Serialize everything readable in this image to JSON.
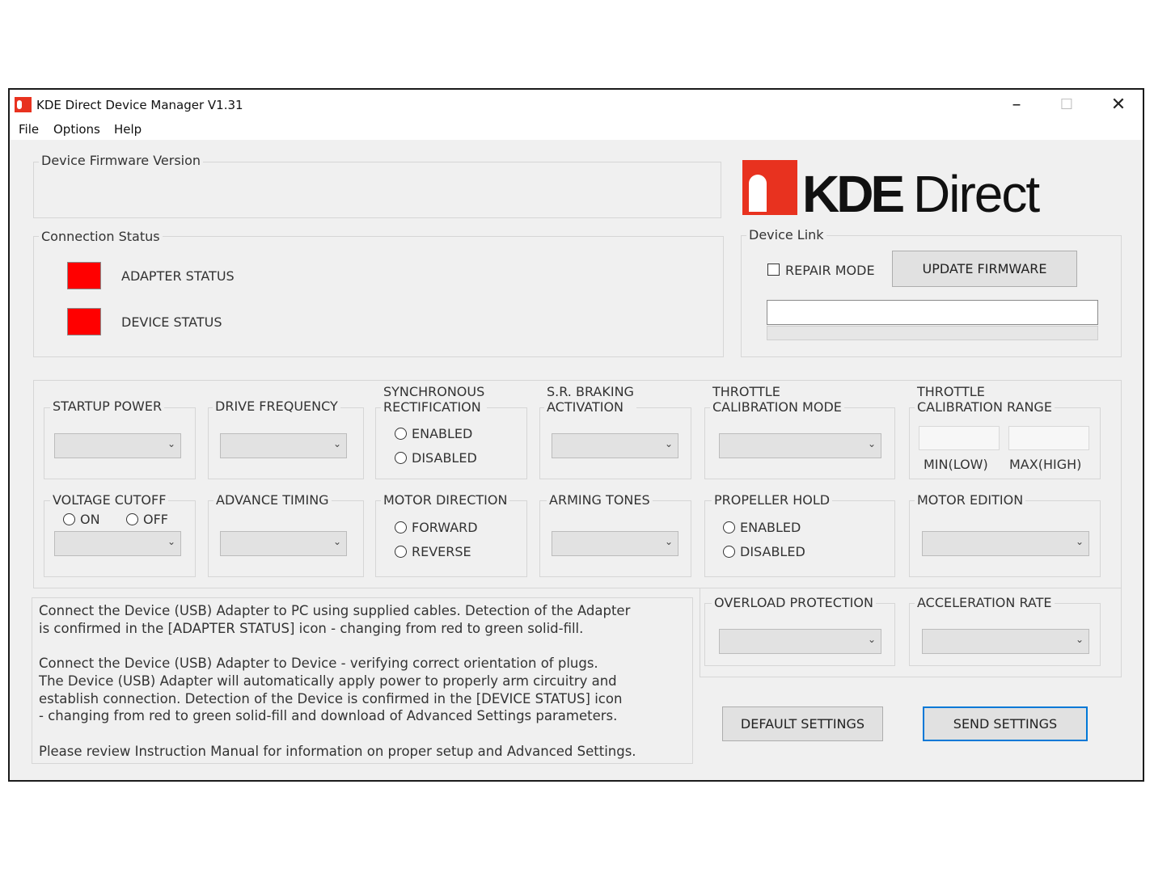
{
  "window": {
    "title": "KDE Direct Device Manager V1.31"
  },
  "menu": [
    "File",
    "Options",
    "Help"
  ],
  "firmware": {
    "legend": "Device Firmware Version"
  },
  "connection": {
    "legend": "Connection Status",
    "adapter": "ADAPTER STATUS",
    "device": "DEVICE STATUS",
    "status_color": "#ff0000"
  },
  "logo": {
    "kde": "KDE",
    "direct": "Direct",
    "accent": "#e8321f"
  },
  "device_link": {
    "legend": "Device Link",
    "repair": "REPAIR MODE",
    "update": "UPDATE FIRMWARE"
  },
  "settings": {
    "startup_power": "STARTUP POWER",
    "drive_frequency": "DRIVE FREQUENCY",
    "sync_rect_1": "SYNCHRONOUS",
    "sync_rect_2": "RECTIFICATION",
    "enabled": "ENABLED",
    "disabled": "DISABLED",
    "sr_braking_1": "S.R. BRAKING",
    "sr_braking_2": "ACTIVATION",
    "throttle_cal_mode_1": "THROTTLE",
    "throttle_cal_mode_2": "CALIBRATION MODE",
    "throttle_cal_range_1": "THROTTLE",
    "throttle_cal_range_2": "CALIBRATION RANGE",
    "min_low": "MIN(LOW)",
    "max_high": "MAX(HIGH)",
    "voltage_cutoff": "VOLTAGE CUTOFF",
    "on": "ON",
    "off": "OFF",
    "advance_timing": "ADVANCE TIMING",
    "motor_direction": "MOTOR DIRECTION",
    "forward": "FORWARD",
    "reverse": "REVERSE",
    "arming_tones": "ARMING TONES",
    "propeller_hold": "PROPELLER HOLD",
    "motor_edition": "MOTOR EDITION",
    "overload_protection": "OVERLOAD PROTECTION",
    "acceleration_rate": "ACCELERATION RATE"
  },
  "info": {
    "line1": "Connect the Device (USB) Adapter to PC using supplied cables.  Detection of the Adapter",
    "line2": "is confirmed in the [ADAPTER STATUS] icon - changing from red to green solid-fill.",
    "line3": "Connect the Device (USB) Adapter to Device - verifying correct orientation of plugs.",
    "line4": "The Device (USB) Adapter will automatically apply power to properly arm circuitry and",
    "line5": "establish connection.  Detection of the Device is confirmed in the [DEVICE STATUS] icon",
    "line6": "- changing from red to green solid-fill and download of Advanced Settings parameters.",
    "line7": "Please review Instruction Manual for information on proper setup and Advanced Settings."
  },
  "buttons": {
    "default": "DEFAULT SETTINGS",
    "send": "SEND SETTINGS"
  }
}
